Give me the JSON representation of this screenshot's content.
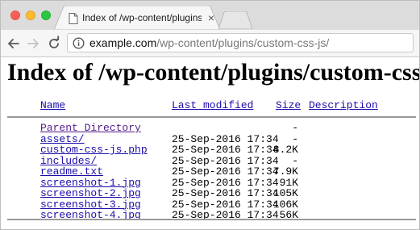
{
  "browser": {
    "tab_title": "Index of /wp-content/plugins/c",
    "close_glyph": "×",
    "url_host": "example.com",
    "url_path": "/wp-content/plugins/custom-css-js/",
    "traffic_lights": {
      "close": "#fc5f57",
      "minimize": "#fdbc2e",
      "zoom": "#28c840"
    },
    "icons": {
      "back": "arrow-left-icon",
      "forward": "arrow-right-icon",
      "reload": "reload-icon",
      "info": "info-icon",
      "tab": "page-icon"
    }
  },
  "page": {
    "heading": "Index of /wp-content/plugins/custom-css-js",
    "columns": {
      "name": "Name",
      "modified": "Last modified",
      "size": "Size",
      "description": "Description"
    },
    "rows": [
      {
        "name": "Parent Directory",
        "date": "",
        "size": "-"
      },
      {
        "name": "assets/",
        "date": "25-Sep-2016 17:34",
        "size": "-"
      },
      {
        "name": "custom-css-js.php",
        "date": "25-Sep-2016 17:34",
        "size": "8.2K"
      },
      {
        "name": "includes/",
        "date": "25-Sep-2016 17:34",
        "size": "-"
      },
      {
        "name": "readme.txt",
        "date": "25-Sep-2016 17:34",
        "size": "7.9K"
      },
      {
        "name": "screenshot-1.jpg",
        "date": "25-Sep-2016 17:34",
        "size": "91K"
      },
      {
        "name": "screenshot-2.jpg",
        "date": "25-Sep-2016 17:34",
        "size": "105K"
      },
      {
        "name": "screenshot-3.jpg",
        "date": "25-Sep-2016 17:34",
        "size": "106K"
      },
      {
        "name": "screenshot-4.jpg",
        "date": "25-Sep-2016 17:34",
        "size": "56K"
      }
    ],
    "colors": {
      "link": "#1a0dab",
      "visited": "#551a8b"
    }
  }
}
